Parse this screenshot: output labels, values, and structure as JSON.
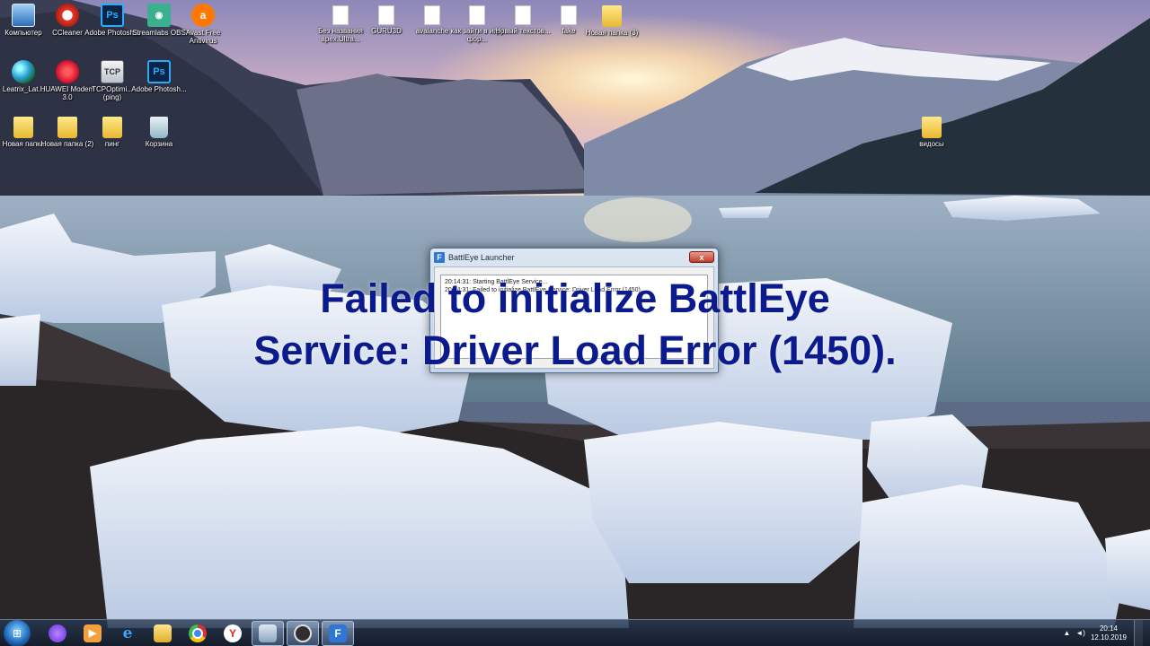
{
  "desktop": {
    "icons": [
      {
        "label": "Компьютер",
        "icon": "computer-icon",
        "glyph": ""
      },
      {
        "label": "CCleaner",
        "icon": "ccleaner-icon",
        "glyph": ""
      },
      {
        "label": "Adobe Photosh...",
        "icon": "photoshop-icon",
        "glyph": "Ps"
      },
      {
        "label": "Streamlabs OBS",
        "icon": "streamlabs-obs-icon",
        "glyph": "◉"
      },
      {
        "label": "Avast Free Antivirus",
        "icon": "avast-icon",
        "glyph": "a"
      },
      {
        "label": "Leatrix_Lat...",
        "icon": "globe-icon",
        "glyph": ""
      },
      {
        "label": "HUAWEI Modem 3.0",
        "icon": "huawei-icon",
        "glyph": ""
      },
      {
        "label": "TCPOptimi... (ping)",
        "icon": "tcpoptimizer-icon",
        "glyph": "TCP"
      },
      {
        "label": "Adobe Photosh...",
        "icon": "photoshop-icon",
        "glyph": "Ps"
      },
      {
        "label": "Новая папка",
        "icon": "folder-icon",
        "glyph": ""
      },
      {
        "label": "Новая папка (2)",
        "icon": "folder-icon",
        "glyph": ""
      },
      {
        "label": "пинг",
        "icon": "folder-icon",
        "glyph": ""
      },
      {
        "label": "Корзина",
        "icon": "recycle-bin-icon",
        "glyph": ""
      },
      {
        "label": "Без названия apex.Ultra...",
        "icon": "document-icon",
        "glyph": ""
      },
      {
        "label": "GURU3D",
        "icon": "document-icon",
        "glyph": ""
      },
      {
        "label": "avalanche",
        "icon": "document-icon",
        "glyph": ""
      },
      {
        "label": "как зайти в игру фор...",
        "icon": "document-icon",
        "glyph": ""
      },
      {
        "label": "Новый текстов...",
        "icon": "document-icon",
        "glyph": ""
      },
      {
        "label": "fake",
        "icon": "document-icon",
        "glyph": ""
      },
      {
        "label": "Новая папка (3)",
        "icon": "folder-icon",
        "glyph": ""
      },
      {
        "label": "видосы",
        "icon": "folder-icon",
        "glyph": ""
      }
    ]
  },
  "dialog": {
    "title": "BattlEye Launcher",
    "app_glyph": "F",
    "close_glyph": "x",
    "log_lines": [
      "20:14:31: Starting BattlEye Service...",
      "20:14:31: Failed to initialize BattlEye Service: Driver Load Error (1450)."
    ]
  },
  "overlay": {
    "line1": "Failed to initialize BattlEye",
    "line2": "Service: Driver Load Error (1450)."
  },
  "taskbar": {
    "start_glyph": "⊞",
    "items": [
      {
        "name": "yandex-alice",
        "glyph": "●",
        "active": false
      },
      {
        "name": "media-player",
        "glyph": "▶",
        "active": false
      },
      {
        "name": "internet-explorer",
        "glyph": "e",
        "active": false
      },
      {
        "name": "file-explorer",
        "glyph": "",
        "active": false
      },
      {
        "name": "chrome",
        "glyph": "",
        "active": false
      },
      {
        "name": "yandex-browser",
        "glyph": "Y",
        "active": false
      },
      {
        "name": "window",
        "glyph": "",
        "active": true
      },
      {
        "name": "obs",
        "glyph": "",
        "active": true
      },
      {
        "name": "battleye-launcher",
        "glyph": "F",
        "active": true
      }
    ],
    "tray": {
      "arrow": "▲",
      "volume": "◄)",
      "time": "20:14",
      "date": "12.10.2019"
    }
  }
}
